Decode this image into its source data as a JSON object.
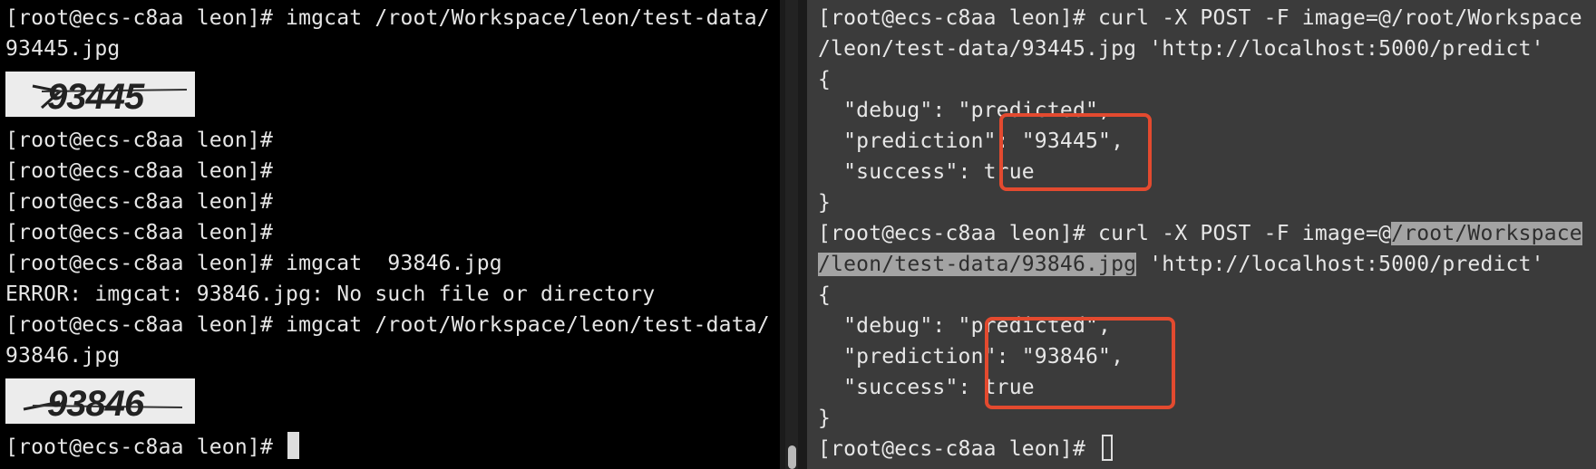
{
  "left_terminal": {
    "lines": [
      "[root@ecs-c8aa leon]# imgcat /root/Workspace/leon/test-data/",
      "93445.jpg",
      "[root@ecs-c8aa leon]#",
      "[root@ecs-c8aa leon]#",
      "[root@ecs-c8aa leon]#",
      "[root@ecs-c8aa leon]#",
      "[root@ecs-c8aa leon]# imgcat  93846.jpg",
      "ERROR: imgcat: 93846.jpg: No such file or directory",
      "[root@ecs-c8aa leon]# imgcat /root/Workspace/leon/test-data/",
      "93846.jpg",
      "[root@ecs-c8aa leon]# "
    ],
    "images": [
      "93445",
      "93846"
    ]
  },
  "right_terminal": {
    "cmd1_line1": "[root@ecs-c8aa leon]# curl -X POST -F image=@/root/Workspace",
    "cmd1_line2": "/leon/test-data/93445.jpg 'http://localhost:5000/predict'",
    "resp1": [
      "{",
      "  \"debug\": \"predicted\",",
      "  \"prediction\": \"93445\",",
      "  \"success\": true",
      "}"
    ],
    "cmd2_prefix": "[root@ecs-c8aa leon]# curl -X POST -F image=@",
    "cmd2_selected1": "/root/Workspace",
    "cmd2_selected2": "/leon/test-data/93846.jpg",
    "cmd2_suffix": " 'http://localhost:5000/predict'",
    "resp2": [
      "{",
      "  \"debug\": \"predicted\",",
      "  \"prediction\": \"93846\",",
      "  \"success\": true",
      "}"
    ],
    "prompt": "[root@ecs-c8aa leon]# "
  },
  "colors": {
    "highlight": "#e34a2f",
    "left_bg": "#000000",
    "right_bg": "#3b3b3b"
  }
}
